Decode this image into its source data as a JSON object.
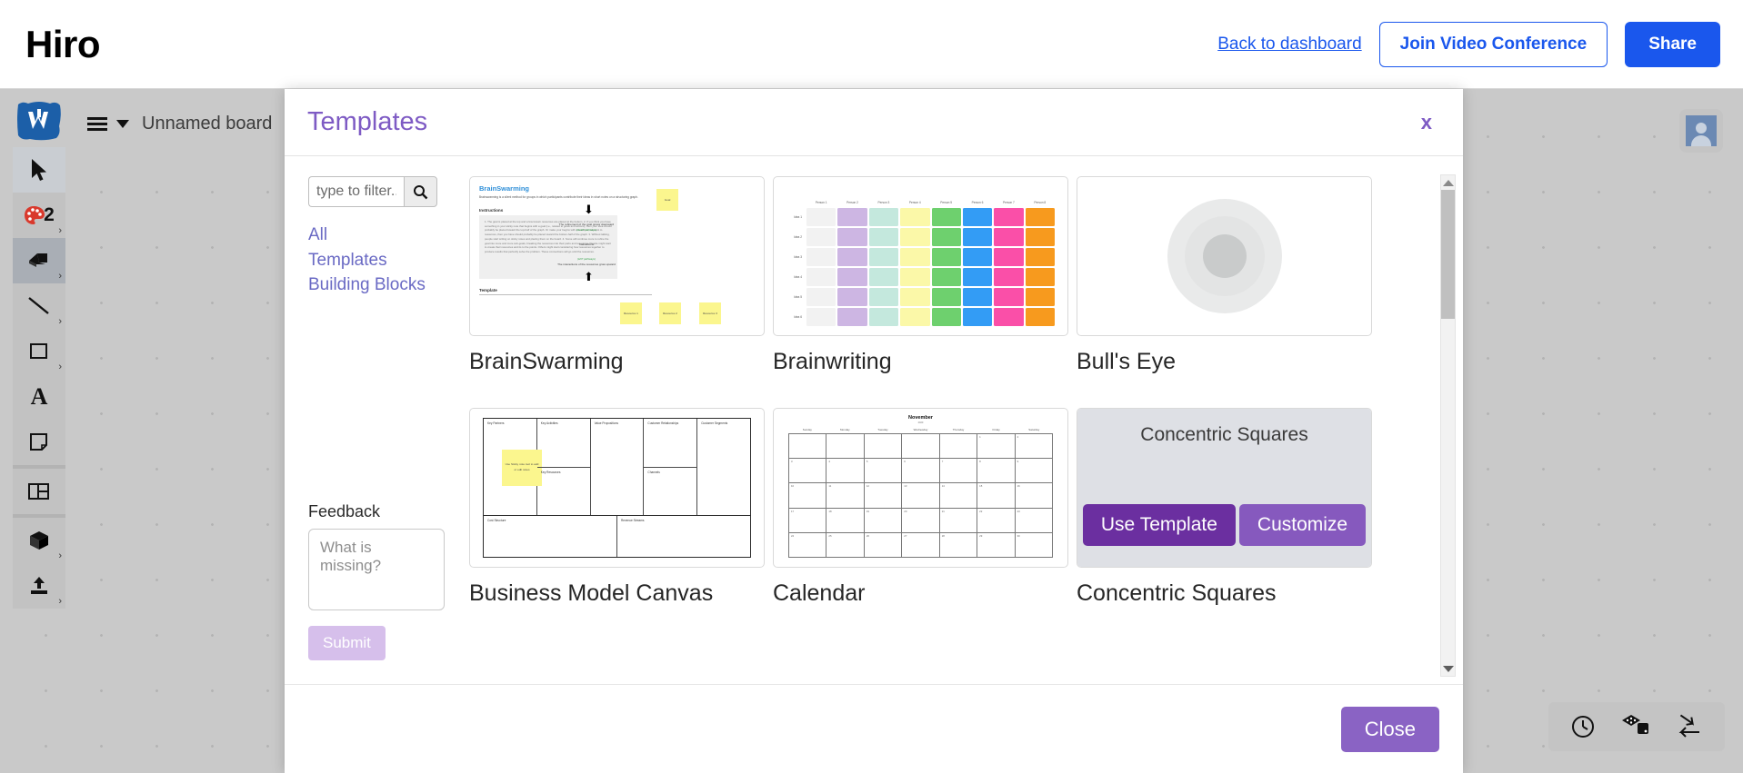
{
  "app": {
    "brand": "Hiro"
  },
  "topbar": {
    "back_link": "Back to dashboard",
    "join_video_label": "Join Video Conference",
    "share_label": "Share"
  },
  "board": {
    "name": "Unnamed board",
    "menu_icon": "hamburger-icon",
    "caret_icon": "chevron-down-icon"
  },
  "toolbar": {
    "logo": "W",
    "items": [
      {
        "name": "select-tool",
        "icon": "cursor-icon",
        "label": "",
        "selected": true,
        "has_more": false
      },
      {
        "name": "color-palette-tool",
        "icon": "palette-icon",
        "label": "2",
        "selected": false,
        "has_more": true
      },
      {
        "name": "eraser-tool",
        "icon": "eraser-icon",
        "label": "",
        "selected": true,
        "has_more": true
      },
      {
        "name": "line-tool",
        "icon": "line-icon",
        "label": "",
        "selected": false,
        "has_more": true
      },
      {
        "name": "shape-tool",
        "icon": "square-icon",
        "label": "",
        "selected": false,
        "has_more": true
      },
      {
        "name": "text-tool",
        "icon": "text-a-icon",
        "label": "A",
        "selected": false,
        "has_more": false
      },
      {
        "name": "sticky-note-tool",
        "icon": "sticky-note-icon",
        "label": "",
        "selected": false,
        "has_more": false
      },
      {
        "name": "frame-tool",
        "icon": "frame-icon",
        "label": "",
        "selected": false,
        "has_more": false
      },
      {
        "name": "object-tool",
        "icon": "cube-icon",
        "label": "",
        "selected": false,
        "has_more": true
      },
      {
        "name": "upload-tool",
        "icon": "upload-icon",
        "label": "",
        "selected": false,
        "has_more": true
      }
    ]
  },
  "canvas_widget": {
    "icons": [
      "clock-icon",
      "dice-icon",
      "shuffle-arrows-icon"
    ]
  },
  "avatar": {
    "name": "user-avatar"
  },
  "modal": {
    "title": "Templates",
    "close_x": "x",
    "close_button": "Close",
    "search": {
      "placeholder": "type to filter...",
      "value": "",
      "icon": "search-icon"
    },
    "categories": [
      {
        "label": "All"
      },
      {
        "label": "Templates"
      },
      {
        "label": "Building Blocks"
      }
    ],
    "feedback": {
      "label": "Feedback",
      "placeholder": "What is missing?",
      "value": "",
      "submit_label": "Submit"
    },
    "hover_card": {
      "title": "Concentric Squares",
      "use_template_label": "Use Template",
      "customize_label": "Customize"
    },
    "templates": [
      {
        "name": "BrainSwarming",
        "hovered": false
      },
      {
        "name": "Brainwriting",
        "hovered": false
      },
      {
        "name": "Bull's Eye",
        "hovered": false
      },
      {
        "name": "Business Model Canvas",
        "hovered": false
      },
      {
        "name": "Calendar",
        "hovered": false
      },
      {
        "name": "Concentric Squares",
        "hovered": true
      }
    ]
  },
  "thumbs": {
    "brainswarming": {
      "title": "BrainSwarming",
      "subtitle": "Brainswarming is a silent method for groups in which participants contribute their ideas in short notes on a structuring graph.",
      "instructions_heading": "Instructions",
      "instructions_text": "1. The goal is placed at the top and a few known resources are placed at the bottom.\n\n2. If you think you have something in your sticky note that begins with a goal (i.e., related to goals and actions), then your idea should probably be placed toward the top-half of the graph. Or make your begins with a resource, relevant to resources, then you have should probably be placed toward the bottom-half of the graph.\n\n3. Without talking, people start writing on sticky notes and placing them on the board.\n\n4. Some will continue more to refine the goal into more and more sub-goals, breaking the resources into their parts and resources. People might start to create their resources and its to the points. Others might start considering how resources together to produce results that perfectly solve the problem. These connections will go until the resources.",
      "template_heading": "Template",
      "goal_sticky": "Goal",
      "caption_top": "The refinement of the goal grows downward",
      "green_top": "(Goal? pathways)",
      "caption_mid": "Interactions",
      "green_bottom": "(left? pathways)",
      "caption_bottom": "The interactions of the resources grow upward",
      "resource_stickies": [
        "Resource 1",
        "Resource 2",
        "Resource 3"
      ]
    },
    "brainwriting": {
      "columns": [
        "Person 1",
        "Person 2",
        "Person 3",
        "Person 4",
        "Person 5",
        "Person 6",
        "Person 7",
        "Person 8"
      ],
      "rows": [
        "Idea 1",
        "Idea 2",
        "Idea 3",
        "Idea 4",
        "Idea 5",
        "Idea 6"
      ],
      "column_colors": [
        "#f2f2f2",
        "#cdb6e3",
        "#c4e8dd",
        "#fbf8a8",
        "#6ed06e",
        "#339cf5",
        "#fa4fa8",
        "#f79a1e"
      ]
    },
    "bullseye": {
      "rings": 3
    },
    "bmc": {
      "cells": {
        "key_partners": "Key Partners",
        "key_activities": "Key Activities",
        "key_resources": "Key Resources",
        "value_propositions": "Value Propositions",
        "customer_relationships": "Customer Relationships",
        "channels": "Channels",
        "customer_segments": "Customer Segments",
        "cost_structure": "Cost Structure",
        "revenue_streams": "Revenue Streams"
      },
      "sticky_text": "Use Sticky note tool to add or edit notes"
    },
    "calendar": {
      "title": "November",
      "year": "2020",
      "days": [
        "Sunday",
        "Monday",
        "Tuesday",
        "Wednesday",
        "Thursday",
        "Friday",
        "Saturday"
      ],
      "dates": [
        "",
        "",
        "",
        "",
        "",
        "1",
        "2",
        "3",
        "4",
        "5",
        "6",
        "7",
        "8",
        "9",
        "10",
        "11",
        "12",
        "13",
        "14",
        "15",
        "16",
        "17",
        "18",
        "19",
        "20",
        "21",
        "22",
        "23",
        "24",
        "25",
        "26",
        "27",
        "28",
        "29",
        "30"
      ]
    }
  },
  "colors": {
    "brand_blue": "#1a57ed",
    "modal_purple": "#7e5bc4",
    "use_template_purple": "#6b2fa0",
    "customize_purple": "#8659be",
    "close_purple": "#8a63c4",
    "submit_purple": "#d6bfeb",
    "canvas_gray": "#c9c9c9"
  }
}
